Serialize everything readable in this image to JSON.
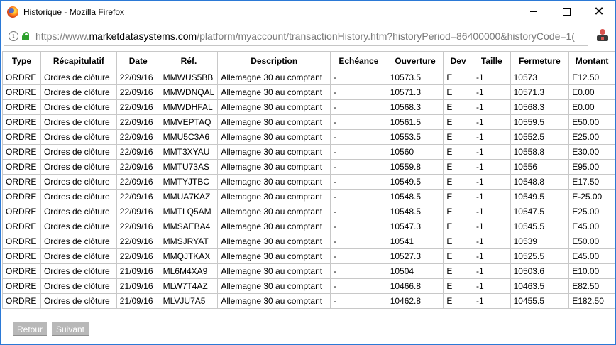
{
  "window": {
    "title": "Historique - Mozilla Firefox",
    "close_glyph": "✕"
  },
  "urlbar": {
    "info_glyph": "i",
    "url_prefix": "https://www.",
    "url_domain": "marketdatasystems.com",
    "url_path": "/platform/myaccount/transactionHistory.htm?historyPeriod=86400000&historyCode=1("
  },
  "table": {
    "headers": [
      "Type",
      "Récapitulatif",
      "Date",
      "Réf.",
      "Description",
      "Echéance",
      "Ouverture",
      "Dev",
      "Taille",
      "Fermeture",
      "Montant"
    ],
    "rows": [
      [
        "ORDRE",
        "Ordres de clôture",
        "22/09/16",
        "MMWUS5BB",
        "Allemagne 30 au comptant",
        "-",
        "10573.5",
        "E",
        "-1",
        "10573",
        "E12.50"
      ],
      [
        "ORDRE",
        "Ordres de clôture",
        "22/09/16",
        "MMWDNQAL",
        "Allemagne 30 au comptant",
        "-",
        "10571.3",
        "E",
        "-1",
        "10571.3",
        "E0.00"
      ],
      [
        "ORDRE",
        "Ordres de clôture",
        "22/09/16",
        "MMWDHFAL",
        "Allemagne 30 au comptant",
        "-",
        "10568.3",
        "E",
        "-1",
        "10568.3",
        "E0.00"
      ],
      [
        "ORDRE",
        "Ordres de clôture",
        "22/09/16",
        "MMVEPTAQ",
        "Allemagne 30 au comptant",
        "-",
        "10561.5",
        "E",
        "-1",
        "10559.5",
        "E50.00"
      ],
      [
        "ORDRE",
        "Ordres de clôture",
        "22/09/16",
        "MMU5C3A6",
        "Allemagne 30 au comptant",
        "-",
        "10553.5",
        "E",
        "-1",
        "10552.5",
        "E25.00"
      ],
      [
        "ORDRE",
        "Ordres de clôture",
        "22/09/16",
        "MMT3XYAU",
        "Allemagne 30 au comptant",
        "-",
        "10560",
        "E",
        "-1",
        "10558.8",
        "E30.00"
      ],
      [
        "ORDRE",
        "Ordres de clôture",
        "22/09/16",
        "MMTU73AS",
        "Allemagne 30 au comptant",
        "-",
        "10559.8",
        "E",
        "-1",
        "10556",
        "E95.00"
      ],
      [
        "ORDRE",
        "Ordres de clôture",
        "22/09/16",
        "MMTYJTBC",
        "Allemagne 30 au comptant",
        "-",
        "10549.5",
        "E",
        "-1",
        "10548.8",
        "E17.50"
      ],
      [
        "ORDRE",
        "Ordres de clôture",
        "22/09/16",
        "MMUA7KAZ",
        "Allemagne 30 au comptant",
        "-",
        "10548.5",
        "E",
        "-1",
        "10549.5",
        "E-25.00"
      ],
      [
        "ORDRE",
        "Ordres de clôture",
        "22/09/16",
        "MMTLQ5AM",
        "Allemagne 30 au comptant",
        "-",
        "10548.5",
        "E",
        "-1",
        "10547.5",
        "E25.00"
      ],
      [
        "ORDRE",
        "Ordres de clôture",
        "22/09/16",
        "MMSAEBA4",
        "Allemagne 30 au comptant",
        "-",
        "10547.3",
        "E",
        "-1",
        "10545.5",
        "E45.00"
      ],
      [
        "ORDRE",
        "Ordres de clôture",
        "22/09/16",
        "MMSJRYAT",
        "Allemagne 30 au comptant",
        "-",
        "10541",
        "E",
        "-1",
        "10539",
        "E50.00"
      ],
      [
        "ORDRE",
        "Ordres de clôture",
        "22/09/16",
        "MMQJTKAX",
        "Allemagne 30 au comptant",
        "-",
        "10527.3",
        "E",
        "-1",
        "10525.5",
        "E45.00"
      ],
      [
        "ORDRE",
        "Ordres de clôture",
        "21/09/16",
        "ML6M4XA9",
        "Allemagne 30 au comptant",
        "-",
        "10504",
        "E",
        "-1",
        "10503.6",
        "E10.00"
      ],
      [
        "ORDRE",
        "Ordres de clôture",
        "21/09/16",
        "MLW7T4AZ",
        "Allemagne 30 au comptant",
        "-",
        "10466.8",
        "E",
        "-1",
        "10463.5",
        "E82.50"
      ],
      [
        "ORDRE",
        "Ordres de clôture",
        "21/09/16",
        "MLVJU7A5",
        "Allemagne 30 au comptant",
        "-",
        "10462.8",
        "E",
        "-1",
        "10455.5",
        "E182.50"
      ]
    ]
  },
  "pagination": {
    "prev_label": "Retour",
    "next_label": "Suivant"
  },
  "colors": {
    "window_border": "#2b79d6",
    "lock": "#2ca02c",
    "button_bg": "#b8b8b8"
  }
}
